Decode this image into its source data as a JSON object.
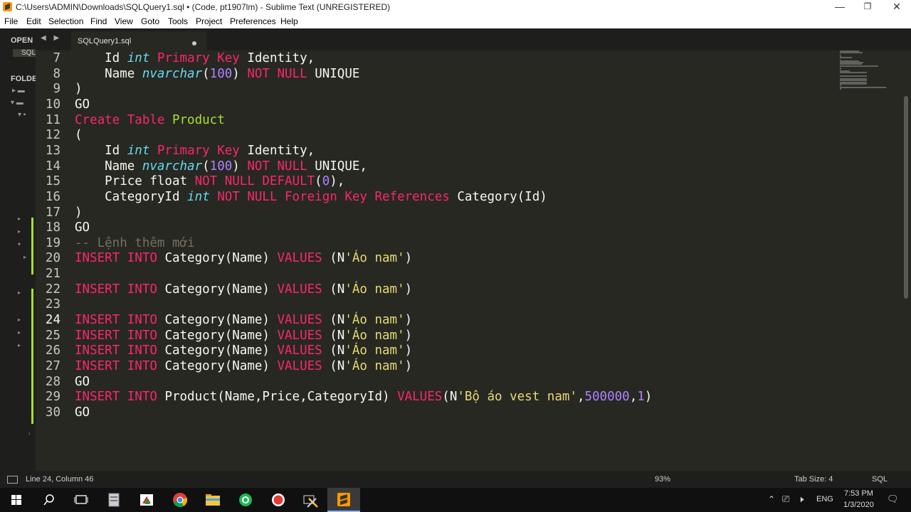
{
  "window": {
    "title": "C:\\Users\\ADMIN\\Downloads\\SQLQuery1.sql • (Code, pt1907lm) - Sublime Text (UNREGISTERED)",
    "minimize": "—",
    "maximize": "❐",
    "close": "✕"
  },
  "menu": [
    "File",
    "Edit",
    "Selection",
    "Find",
    "View",
    "Goto",
    "Tools",
    "Project",
    "Preferences",
    "Help"
  ],
  "sidebar": {
    "open_files_header": "OPEN",
    "open_file": "SQL",
    "folders_header": "FOLDE"
  },
  "tab": {
    "label": "SQLQuery1.sql",
    "nav": "◀ ▶"
  },
  "editor": {
    "current_line": 24,
    "lines": [
      {
        "n": "7",
        "tokens": [
          [
            "",
            "    Id "
          ],
          [
            "ty",
            "int"
          ],
          [
            "",
            " "
          ],
          [
            "kw",
            "Primary Key"
          ],
          [
            "",
            " Identity,"
          ]
        ]
      },
      {
        "n": "8",
        "tokens": [
          [
            "",
            "    Name "
          ],
          [
            "ty",
            "nvarchar"
          ],
          [
            "",
            "("
          ],
          [
            "nm",
            "100"
          ],
          [
            "",
            ") "
          ],
          [
            "kw",
            "NOT NULL"
          ],
          [
            "",
            " UNIQUE"
          ]
        ]
      },
      {
        "n": "9",
        "tokens": [
          [
            "",
            ")"
          ]
        ]
      },
      {
        "n": "10",
        "tokens": [
          [
            "",
            "GO"
          ]
        ]
      },
      {
        "n": "11",
        "tokens": [
          [
            "kw",
            "Create Table"
          ],
          [
            "",
            " "
          ],
          [
            "fn",
            "Product"
          ]
        ]
      },
      {
        "n": "12",
        "tokens": [
          [
            "",
            "("
          ]
        ]
      },
      {
        "n": "13",
        "tokens": [
          [
            "",
            "    Id "
          ],
          [
            "ty",
            "int"
          ],
          [
            "",
            " "
          ],
          [
            "kw",
            "Primary Key"
          ],
          [
            "",
            " Identity,"
          ]
        ]
      },
      {
        "n": "14",
        "tokens": [
          [
            "",
            "    Name "
          ],
          [
            "ty",
            "nvarchar"
          ],
          [
            "",
            "("
          ],
          [
            "nm",
            "100"
          ],
          [
            "",
            ") "
          ],
          [
            "kw",
            "NOT NULL"
          ],
          [
            "",
            " UNIQUE,"
          ]
        ]
      },
      {
        "n": "15",
        "tokens": [
          [
            "",
            "    Price float "
          ],
          [
            "kw",
            "NOT NULL DEFAULT"
          ],
          [
            "",
            "("
          ],
          [
            "nm",
            "0"
          ],
          [
            "",
            "),"
          ]
        ]
      },
      {
        "n": "16",
        "tokens": [
          [
            "",
            "    CategoryId "
          ],
          [
            "ty",
            "int"
          ],
          [
            "",
            " "
          ],
          [
            "kw",
            "NOT NULL Foreign Key References"
          ],
          [
            "",
            " Category(Id)"
          ]
        ]
      },
      {
        "n": "17",
        "tokens": [
          [
            "",
            ")"
          ]
        ]
      },
      {
        "n": "18",
        "tokens": [
          [
            "",
            "GO"
          ]
        ]
      },
      {
        "n": "19",
        "tokens": [
          [
            "cm",
            "-- Lệnh thêm mới"
          ]
        ]
      },
      {
        "n": "20",
        "tokens": [
          [
            "kw",
            "INSERT INTO"
          ],
          [
            "",
            " Category(Name) "
          ],
          [
            "kw",
            "VALUES"
          ],
          [
            "",
            " (N"
          ],
          [
            "st",
            "'Áo nam'"
          ],
          [
            "",
            ")"
          ]
        ]
      },
      {
        "n": "21",
        "tokens": []
      },
      {
        "n": "22",
        "tokens": [
          [
            "kw",
            "INSERT INTO"
          ],
          [
            "",
            " Category(Name) "
          ],
          [
            "kw",
            "VALUES"
          ],
          [
            "",
            " (N"
          ],
          [
            "st",
            "'Áo nam'"
          ],
          [
            "",
            ")"
          ]
        ]
      },
      {
        "n": "23",
        "tokens": []
      },
      {
        "n": "24",
        "tokens": [
          [
            "kw",
            "INSERT INTO"
          ],
          [
            "",
            " Category(Name) "
          ],
          [
            "kw",
            "VALUES"
          ],
          [
            "",
            " (N"
          ],
          [
            "st",
            "'Áo nam'"
          ],
          [
            "",
            ")"
          ]
        ]
      },
      {
        "n": "25",
        "tokens": [
          [
            "kw",
            "INSERT INTO"
          ],
          [
            "",
            " Category(Name) "
          ],
          [
            "kw",
            "VALUES"
          ],
          [
            "",
            " (N"
          ],
          [
            "st",
            "'Áo nam'"
          ],
          [
            "",
            ")"
          ]
        ]
      },
      {
        "n": "26",
        "tokens": [
          [
            "kw",
            "INSERT INTO"
          ],
          [
            "",
            " Category(Name) "
          ],
          [
            "kw",
            "VALUES"
          ],
          [
            "",
            " (N"
          ],
          [
            "st",
            "'Áo nam'"
          ],
          [
            "",
            ")"
          ]
        ]
      },
      {
        "n": "27",
        "tokens": [
          [
            "kw",
            "INSERT INTO"
          ],
          [
            "",
            " Category(Name) "
          ],
          [
            "kw",
            "VALUES"
          ],
          [
            "",
            " (N"
          ],
          [
            "st",
            "'Áo nam'"
          ],
          [
            "",
            ")"
          ]
        ]
      },
      {
        "n": "28",
        "tokens": [
          [
            "",
            "GO"
          ]
        ]
      },
      {
        "n": "29",
        "tokens": [
          [
            "kw",
            "INSERT INTO"
          ],
          [
            "",
            " Product(Name,Price,CategoryId) "
          ],
          [
            "kw",
            "VALUES"
          ],
          [
            "",
            "(N"
          ],
          [
            "st",
            "'Bộ áo vest nam'"
          ],
          [
            "",
            ","
          ],
          [
            "nm",
            "500000"
          ],
          [
            "",
            ","
          ],
          [
            "nm",
            "1"
          ],
          [
            "",
            ")"
          ]
        ]
      },
      {
        "n": "30",
        "tokens": [
          [
            "",
            "GO"
          ]
        ]
      }
    ]
  },
  "status": {
    "position": "Line 24, Column 46",
    "zoom": "93%",
    "tab_size": "Tab Size: 4",
    "syntax": "SQL"
  },
  "taskbar": {
    "icons": [
      "windows-start-icon",
      "search-icon",
      "task-view-icon",
      "file-icon",
      "sql-app-icon",
      "chrome-icon",
      "file-explorer-icon",
      "green-circle-app-icon",
      "red-record-app-icon",
      "tools-icon",
      "sublime-text-icon"
    ],
    "language": "ENG",
    "time": "7:53 PM",
    "date": "1/3/2020"
  }
}
